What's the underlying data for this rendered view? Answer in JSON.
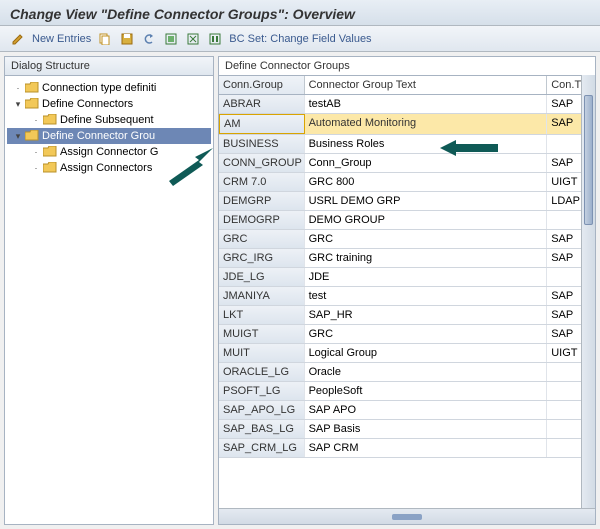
{
  "title": "Change View \"Define Connector Groups\": Overview",
  "toolbar": {
    "new_entries": "New Entries",
    "bc_set": "BC Set: Change Field Values"
  },
  "sidebar": {
    "heading": "Dialog Structure",
    "items": [
      {
        "label": "Connection type definiti",
        "indent": 0,
        "toggle": "·"
      },
      {
        "label": "Define Connectors",
        "indent": 0,
        "toggle": "▾"
      },
      {
        "label": "Define Subsequent",
        "indent": 1,
        "toggle": "·"
      },
      {
        "label": "Define Connector Grou",
        "indent": 0,
        "toggle": "▾",
        "selected": true
      },
      {
        "label": "Assign Connector G",
        "indent": 1,
        "toggle": "·"
      },
      {
        "label": "Assign Connectors",
        "indent": 1,
        "toggle": "·"
      }
    ]
  },
  "grid": {
    "title": "Define Connector Groups",
    "columns": [
      "Conn.Group",
      "Connector Group Text",
      "Con.T"
    ],
    "rows": [
      {
        "a": "ABRAR",
        "b": "testAB",
        "c": "SAP"
      },
      {
        "a": "AM",
        "b": "Automated Monitoring",
        "c": "SAP",
        "highlight": true
      },
      {
        "a": "BUSINESS",
        "b": "Business Roles",
        "c": ""
      },
      {
        "a": "CONN_GROUP",
        "b": "Conn_Group",
        "c": "SAP"
      },
      {
        "a": "CRM 7.0",
        "b": "GRC 800",
        "c": "UIGT"
      },
      {
        "a": "DEMGRP",
        "b": "USRL DEMO GRP",
        "c": "LDAP"
      },
      {
        "a": "DEMOGRP",
        "b": "DEMO GROUP",
        "c": ""
      },
      {
        "a": "GRC",
        "b": "GRC",
        "c": "SAP"
      },
      {
        "a": "GRC_IRG",
        "b": "GRC training",
        "c": "SAP"
      },
      {
        "a": "JDE_LG",
        "b": "JDE",
        "c": ""
      },
      {
        "a": "JMANIYA",
        "b": "test",
        "c": "SAP"
      },
      {
        "a": "LKT",
        "b": "SAP_HR",
        "c": "SAP"
      },
      {
        "a": "MUIGT",
        "b": "GRC",
        "c": "SAP"
      },
      {
        "a": "MUIT",
        "b": "Logical Group",
        "c": "UIGT"
      },
      {
        "a": "ORACLE_LG",
        "b": "Oracle",
        "c": ""
      },
      {
        "a": "PSOFT_LG",
        "b": "PeopleSoft",
        "c": ""
      },
      {
        "a": "SAP_APO_LG",
        "b": "SAP APO",
        "c": ""
      },
      {
        "a": "SAP_BAS_LG",
        "b": "SAP Basis",
        "c": ""
      },
      {
        "a": "SAP_CRM_LG",
        "b": "SAP CRM",
        "c": ""
      }
    ]
  }
}
